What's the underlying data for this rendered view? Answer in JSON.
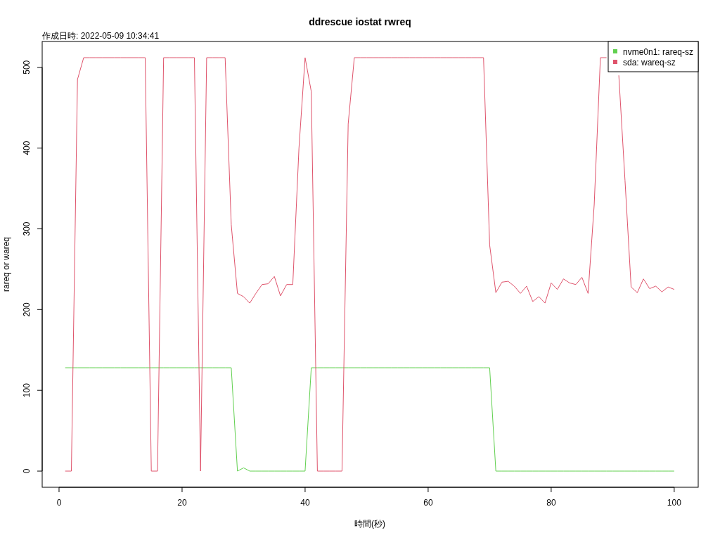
{
  "plot": {
    "subtitle": "作成日時: 2022-05-09 10:34:41",
    "chart_data": {
      "type": "line",
      "title": "ddrescue iostat rwreq",
      "xlabel": "時間(秒)",
      "ylabel": "rareq or wareq",
      "x": [
        1,
        2,
        3,
        4,
        5,
        6,
        7,
        8,
        9,
        10,
        11,
        12,
        13,
        14,
        15,
        16,
        17,
        18,
        19,
        20,
        21,
        22,
        23,
        24,
        25,
        26,
        27,
        28,
        29,
        30,
        31,
        32,
        33,
        34,
        35,
        36,
        37,
        38,
        39,
        40,
        41,
        42,
        43,
        44,
        45,
        46,
        47,
        48,
        49,
        50,
        51,
        52,
        53,
        54,
        55,
        56,
        57,
        58,
        59,
        60,
        61,
        62,
        63,
        64,
        65,
        66,
        67,
        68,
        69,
        70,
        71,
        72,
        73,
        74,
        75,
        76,
        77,
        78,
        79,
        80,
        81,
        82,
        83,
        84,
        85,
        86,
        87,
        88,
        89,
        90,
        91,
        92,
        93,
        94,
        95,
        96,
        97,
        98,
        99,
        100
      ],
      "series": [
        {
          "name": "nvme0n1: rareq-sz",
          "color": "#61d04f",
          "values": [
            128,
            128,
            128,
            128,
            128,
            128,
            128,
            128,
            128,
            128,
            128,
            128,
            128,
            128,
            128,
            128,
            128,
            128,
            128,
            128,
            128,
            128,
            128,
            128,
            128,
            128,
            128,
            128,
            0,
            4,
            0,
            0,
            0,
            0,
            0,
            0,
            0,
            0,
            0,
            0,
            128,
            128,
            128,
            128,
            128,
            128,
            128,
            128,
            128,
            128,
            128,
            128,
            128,
            128,
            128,
            128,
            128,
            128,
            128,
            128,
            128,
            128,
            128,
            128,
            128,
            128,
            128,
            128,
            128,
            128,
            0,
            0,
            0,
            0,
            0,
            0,
            0,
            0,
            0,
            0,
            0,
            0,
            0,
            0,
            0,
            0,
            0,
            0,
            0,
            0,
            0,
            0,
            0,
            0,
            0,
            0,
            0,
            0,
            0,
            0
          ]
        },
        {
          "name": "sda: wareq-sz",
          "color": "#df536b",
          "values": [
            0,
            0,
            485,
            512,
            512,
            512,
            512,
            512,
            512,
            512,
            512,
            512,
            512,
            512,
            0,
            0,
            512,
            512,
            512,
            512,
            512,
            512,
            0,
            512,
            512,
            512,
            512,
            305,
            220,
            216,
            208,
            220,
            231,
            232,
            241,
            217,
            231,
            231,
            400,
            512,
            470,
            0,
            0,
            0,
            0,
            0,
            430,
            512,
            512,
            512,
            512,
            512,
            512,
            512,
            512,
            512,
            512,
            512,
            512,
            512,
            512,
            512,
            512,
            512,
            512,
            512,
            512,
            512,
            512,
            280,
            221,
            234,
            235,
            229,
            220,
            229,
            210,
            216,
            208,
            233,
            225,
            238,
            233,
            231,
            240,
            220,
            330,
            512,
            512,
            null,
            490,
            360,
            228,
            221,
            238,
            226,
            229,
            222,
            228,
            225
          ]
        }
      ],
      "legend": true,
      "xlim": [
        -2.74,
        103.9
      ],
      "ylim": [
        -20,
        532
      ],
      "xticks": [
        0,
        20,
        40,
        60,
        80,
        100
      ],
      "yticks": [
        0,
        100,
        200,
        300,
        400,
        500
      ]
    }
  }
}
